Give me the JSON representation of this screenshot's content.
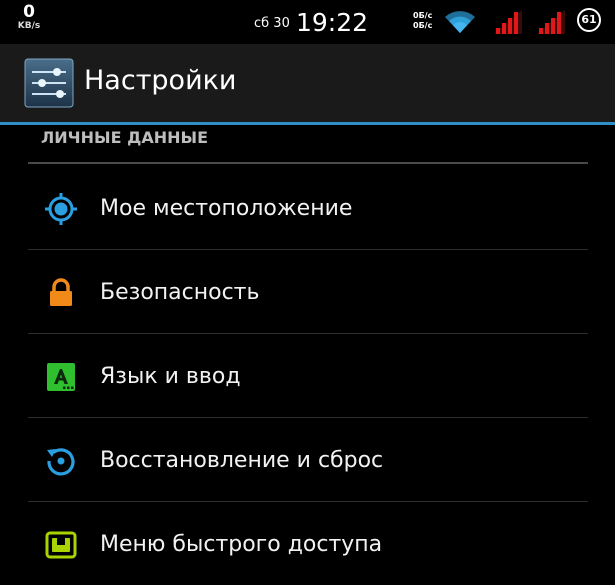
{
  "status_bar": {
    "net_speed_value": "0",
    "net_speed_unit": "KB/s",
    "date": "сб 30",
    "time": "19:22",
    "traffic_up": "0Б/с",
    "traffic_down": "0Б/с",
    "battery": "61",
    "icons": [
      "wifi-icon",
      "signal-icon",
      "signal-icon",
      "battery-icon"
    ]
  },
  "action_bar": {
    "title": "Настройки",
    "icon": "settings-sliders-icon"
  },
  "section": {
    "header": "ЛИЧНЫЕ ДАННЫЕ"
  },
  "items": [
    {
      "label": "Мое местоположение",
      "icon": "location-icon",
      "color": "#2a9fe2"
    },
    {
      "label": "Безопасность",
      "icon": "lock-icon",
      "color": "#f28a1a"
    },
    {
      "label": "Язык и ввод",
      "icon": "keyboard-language-icon",
      "color": "#2fbf2f"
    },
    {
      "label": "Восстановление и сброс",
      "icon": "backup-restore-icon",
      "color": "#2a9fe2"
    },
    {
      "label": "Меню быстрого доступа",
      "icon": "quick-access-icon",
      "color": "#a9d400"
    }
  ],
  "colors": {
    "accent_line": "#2f8ec5",
    "signal": "#e01818"
  }
}
